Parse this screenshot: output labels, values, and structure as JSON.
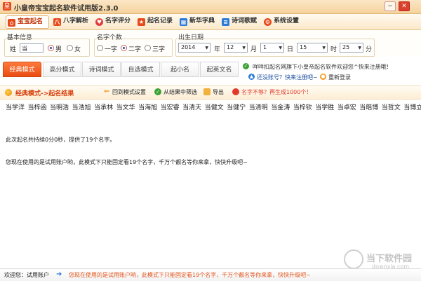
{
  "window": {
    "title": "小皇帝宝宝起名软件试用版2.3.0",
    "app_icon_glyph": "皇"
  },
  "menu": {
    "items": [
      {
        "label": "宝宝起名",
        "icon": "home-icon",
        "color": "#e64b1c"
      },
      {
        "label": "八字解析",
        "icon": "bazi-icon",
        "color": "#e64b1c"
      },
      {
        "label": "名字评分",
        "icon": "heart-icon",
        "color": "#e33c3c"
      },
      {
        "label": "起名记录",
        "icon": "star-icon",
        "color": "#e64b1c"
      },
      {
        "label": "新华字典",
        "icon": "dictionary-icon",
        "color": "#2a7bd8"
      },
      {
        "label": "诗词歌赋",
        "icon": "poetry-icon",
        "color": "#2a7bd8"
      },
      {
        "label": "系统设置",
        "icon": "gear-icon",
        "color": "#e64b1c"
      }
    ]
  },
  "basic_info": {
    "label": "基本信息",
    "surname_label": "姓",
    "surname_value": "当",
    "gender_male": "男",
    "gender_female": "女"
  },
  "name_length": {
    "label": "名字个数",
    "one": "一字",
    "two": "二字",
    "three": "三字"
  },
  "birth": {
    "label": "出生日期",
    "year": "2014",
    "year_unit": "年",
    "month": "12",
    "month_unit": "月",
    "day": "1",
    "day_unit": "日",
    "hour": "15",
    "hour_unit": "时",
    "minute": "25",
    "minute_unit": "分"
  },
  "tabs": [
    "经典模式",
    "高分模式",
    "诗词模式",
    "自选模式",
    "起小名",
    "起英文名"
  ],
  "info_panel": {
    "welcome": "咩咩扣起名网旗下小皇帝起名软件欢迎您^快来注册哦!",
    "register": "还没账号？快来注册吧~",
    "relogin": "重新登录"
  },
  "actionbar": {
    "crumb": "经典模式->起名结果",
    "back": "回到模式设置",
    "filter": "从结果中筛选",
    "export": "导出",
    "not_enough": "名字不够？再生成1000个！"
  },
  "results": {
    "names": [
      "当学洋",
      "当梓函",
      "当明浩",
      "当浩旭",
      "当承林",
      "当文华",
      "当海旭",
      "当宏睿",
      "当清天",
      "当健文",
      "当健宁",
      "当清明",
      "当金涛",
      "当梓钦",
      "当学胜",
      "当卓宏",
      "当皓博",
      "当哲文",
      "当博立"
    ],
    "summary": "此次起名共持续0分0秒，提供了19个名字。",
    "limit_note": "您现在使用的是试用账户哟，此模式下只能固定看19个名字，千万个靓名等你来拿，快快升级吧~"
  },
  "watermark": {
    "title": "当下软件园",
    "sub": "downxia.com"
  },
  "statusbar": {
    "welcome": "欢迎您：试用账户",
    "message": "您现在使用的是试用账户哟，此模式下只能固定看19个名字，千万个靓名等你来拿，快快升级吧~"
  }
}
